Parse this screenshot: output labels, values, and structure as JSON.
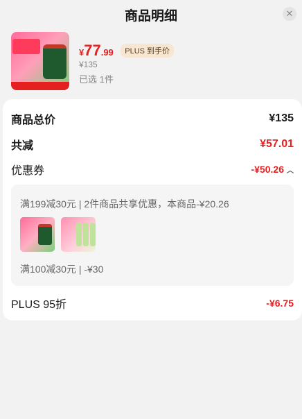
{
  "header": {
    "title": "商品明细",
    "close_label": "✕"
  },
  "product": {
    "price_symbol": "¥",
    "price_int": "77",
    "price_dec": ".99",
    "plus_badge": "PLUS 到手价",
    "original_price": "¥135",
    "quantity": "已选 1件"
  },
  "summary": {
    "total_label": "商品总价",
    "total_value": "¥135",
    "discount_label": "共减",
    "discount_value": "¥57.01",
    "coupon_label": "优惠券",
    "coupon_value": "-¥50.26",
    "coupon_detail_1": "满199减30元 | 2件商品共享优惠，本商品-¥20.26",
    "coupon_detail_2": "满100减30元 | -¥30",
    "plus_label": "PLUS 95折",
    "plus_value": "-¥6.75"
  },
  "colors": {
    "accent_red": "#e52020",
    "plus_badge_bg": "#f7e6d2"
  },
  "icons": {
    "close": "close-icon",
    "chevron": "chevron-up-icon"
  }
}
